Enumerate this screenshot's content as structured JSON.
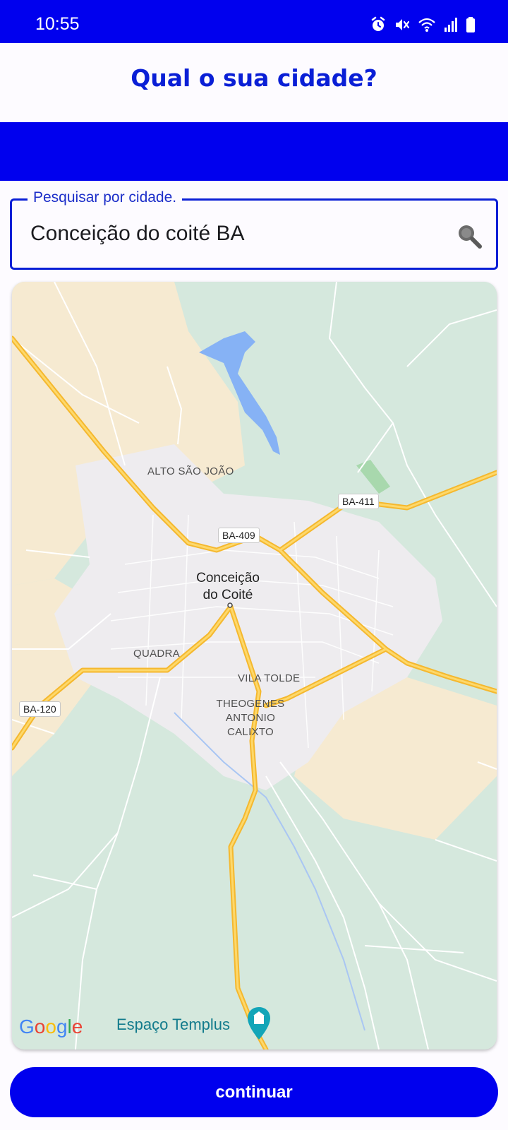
{
  "status_bar": {
    "time": "10:55",
    "icons": [
      "alarm-icon",
      "mute-icon",
      "wifi-icon",
      "signal-icon",
      "battery-icon"
    ]
  },
  "header": {
    "title": "Qual o sua cidade?"
  },
  "search": {
    "label": "Pesquisar por cidade.",
    "value": "Conceição do coité BA",
    "icon": "search-icon"
  },
  "map": {
    "city_label": "Conceição do Coité",
    "neighborhoods": [
      "ALTO SÃO JOÃO",
      "QUADRA",
      "VILA TOLDE",
      "THEOGENES ANTONIO CALIXTO"
    ],
    "roads": [
      "BA-411",
      "BA-409",
      "BA-120"
    ],
    "attribution": "Google",
    "poi": "Espaço Templus"
  },
  "colors": {
    "brand_blue": "#0000ee",
    "title_blue": "#0a1fd6",
    "map_green": "#d5e8dd",
    "map_urban": "#eeecef",
    "map_sand": "#f6ead1",
    "road_major": "#fbc02d",
    "water": "#86b2f5"
  },
  "actions": {
    "continue_label": "continuar"
  }
}
